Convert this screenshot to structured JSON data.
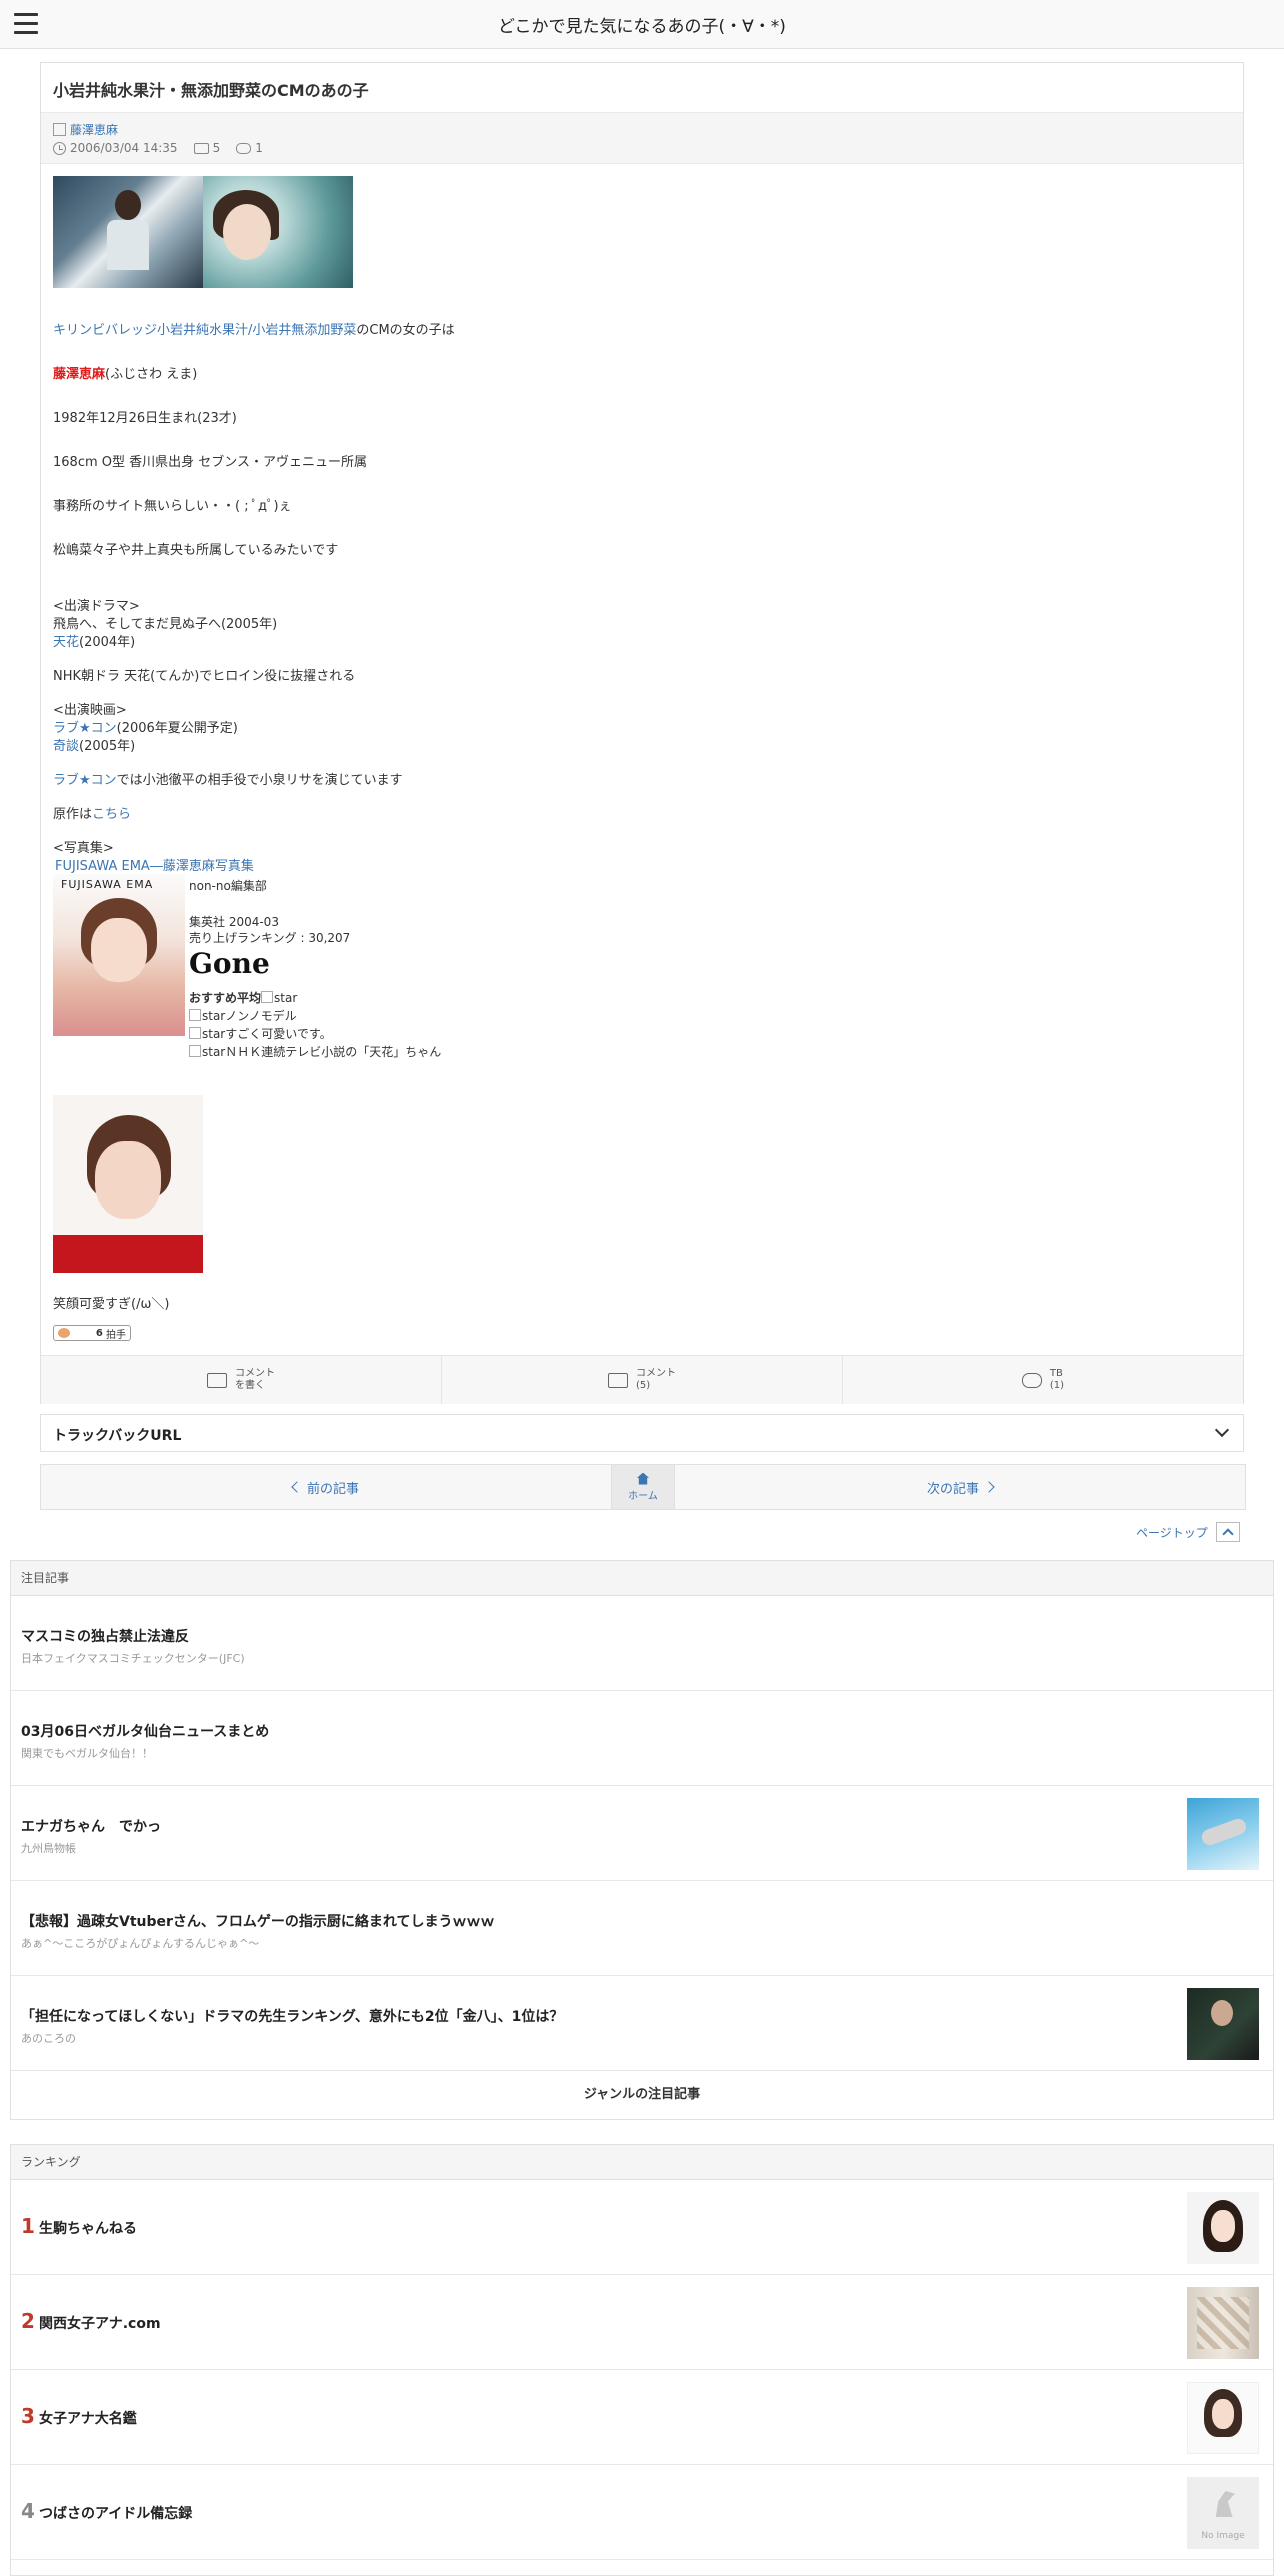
{
  "header": {
    "site_title": "どこかで見た気になるあの子(・∀・*)"
  },
  "article": {
    "title": "小岩井純水果汁・無添加野菜のCMのあの子",
    "category": "藤澤恵麻",
    "date": "2006/03/04 14:35",
    "comment_count": "5",
    "trackback_count": "1",
    "body": {
      "intro_link": "キリンビバレッジ小岩井純水果汁/小岩井無添加野菜",
      "intro_rest": "のCMの女の子は",
      "name": "藤澤恵麻",
      "name_reading": "(ふじさわ えま)",
      "birth": "1982年12月26日生まれ(23才)",
      "profile": "168cm O型 香川県出身 セブンス・アヴェニュー所属",
      "site_note": "事務所のサイト無いらしい・・( ; ﾟдﾟ)ぇ",
      "agency_note": "松嶋菜々子や井上真央も所属しているみたいです",
      "drama_head": "<出演ドラマ>",
      "drama1": "飛鳥へ、そしてまだ見ぬ子へ(2005年)",
      "drama2_link": "天花",
      "drama2_year": "(2004年)",
      "drama_note": "NHK朝ドラ 天花(てんか)でヒロイン役に抜擢される",
      "movie_head": "<出演映画>",
      "movie1_link": "ラブ★コン",
      "movie1_rest": "(2006年夏公開予定)",
      "movie2_link": "奇談",
      "movie2_rest": "(2005年)",
      "lovecom_link": "ラブ★コン",
      "lovecom_rest": "では小池徹平の相手役で小泉リサを演じています",
      "original_label": "原作は",
      "original_link": "こちら",
      "photobook_head": "<写真集>",
      "photobook_link": "FUJISAWA EMA―藤澤恵麻写真集",
      "photobook_cover_text": "FUJISAWA EMA",
      "book_editor": "non-no編集部",
      "book_publisher": "集英社 2004-03",
      "book_rank": "売り上げランキング : 30,207",
      "book_status": "Gone",
      "rec_label": "おすすめ平均",
      "star_alt": "star",
      "review1": "ノンノモデル",
      "review2": "すごく可愛いです。",
      "review3": "ＮＨＫ連続テレビ小説の「天花」ちゃん",
      "caption": "笑顔可愛すぎ(/ω＼)",
      "clap_count": "6",
      "clap_unit": "拍手"
    },
    "actions": {
      "write_comment_1": "コメント",
      "write_comment_2": "を書く",
      "comment_1": "コメント",
      "comment_2": "(5)",
      "tb_1": "TB",
      "tb_2": "(1)"
    }
  },
  "trackback": {
    "label": "トラックバックURL"
  },
  "pager": {
    "prev": "前の記事",
    "home": "ホーム",
    "next": "次の記事"
  },
  "pagetop": "ページトップ",
  "featured": {
    "heading": "注目記事",
    "items": [
      {
        "title": "マスコミの独占禁止法違反",
        "source": "日本フェイクマスコミチェックセンター(JFC)"
      },
      {
        "title": "03月06日ベガルタ仙台ニュースまとめ",
        "source": "関東でもベガルタ仙台！！"
      },
      {
        "title": "エナガちゃん　でかっ",
        "source": "九州鳥物帳"
      },
      {
        "title": "【悲報】過疎女Vtuberさん、フロムゲーの指示厨に絡まれてしまうｗｗｗ",
        "source": "あぁ^～こころがぴょんぴょんするんじゃぁ^～"
      },
      {
        "title": "「担任になってほしくない」ドラマの先生ランキング、意外にも2位「金八」、1位は？",
        "source": "あのころの"
      }
    ],
    "more": "ジャンルの注目記事"
  },
  "ranking": {
    "heading": "ランキング",
    "items": [
      {
        "rank": "1",
        "name": "生駒ちゃんねる"
      },
      {
        "rank": "2",
        "name": "関西女子アナ.com"
      },
      {
        "rank": "3",
        "name": "女子アナ大名鑑"
      },
      {
        "rank": "4",
        "name": "つばさのアイドル備忘録"
      }
    ],
    "no_image": "No Image"
  },
  "colors": {
    "link": "#3b75b3",
    "accent_red": "#e01a1a",
    "rank_red": "#c0392b"
  }
}
